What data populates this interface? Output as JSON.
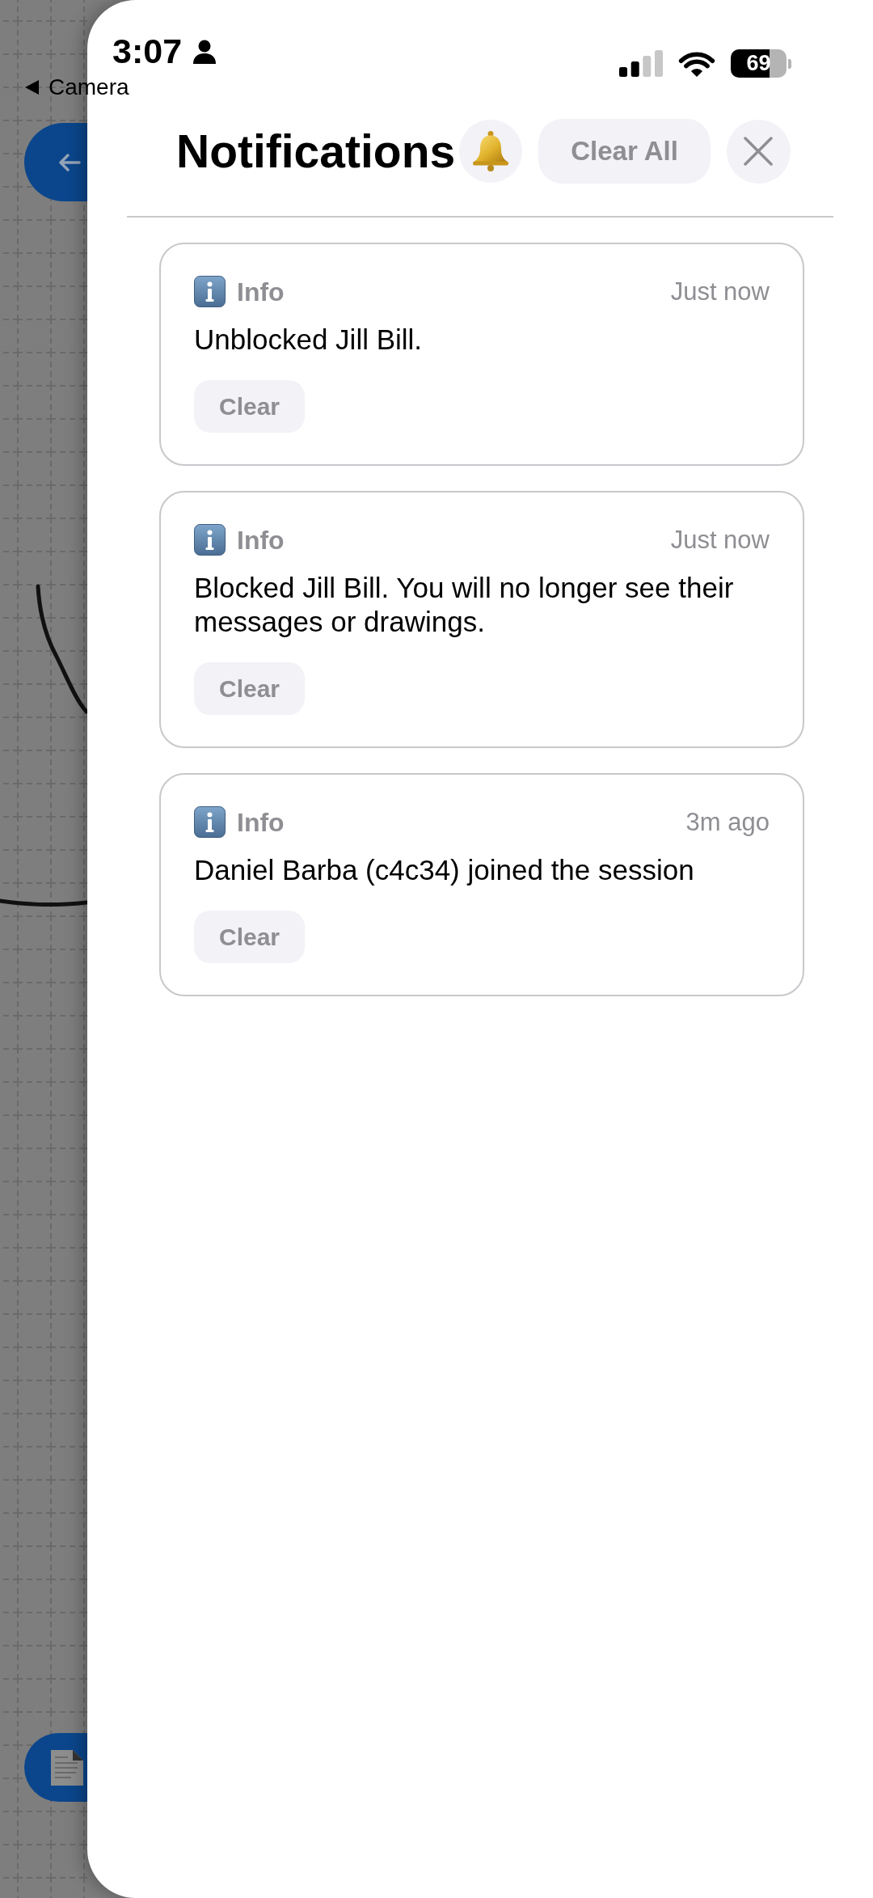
{
  "status_bar": {
    "time": "3:07",
    "back_label": "Camera",
    "battery": "69"
  },
  "header": {
    "title": "Notifications",
    "clear_all": "Clear All"
  },
  "notifications": [
    {
      "category": "Info",
      "time": "Just now",
      "message": "Unblocked Jill Bill.",
      "clear_label": "Clear"
    },
    {
      "category": "Info",
      "time": "Just now",
      "message": "Blocked Jill Bill. You will no longer see their messages or drawings.",
      "clear_label": "Clear"
    },
    {
      "category": "Info",
      "time": "3m ago",
      "message": "Daniel Barba (c4c34) joined the session",
      "clear_label": "Clear"
    }
  ]
}
